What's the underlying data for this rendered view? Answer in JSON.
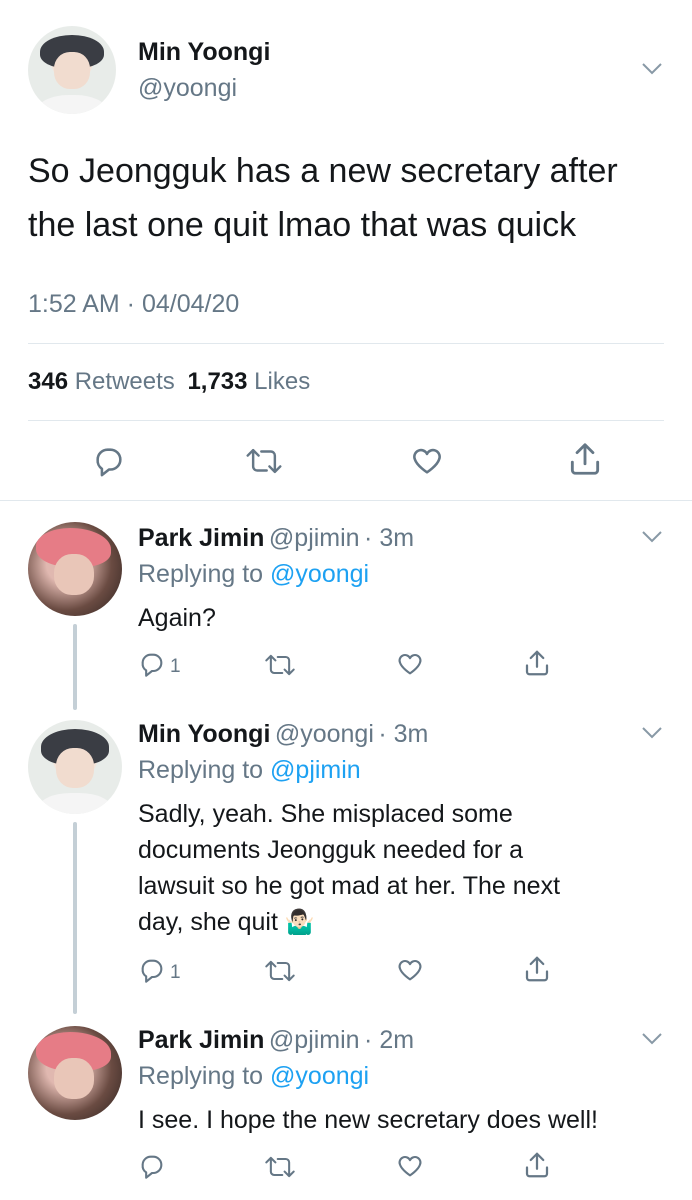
{
  "main_tweet": {
    "name": "Min Yoongi",
    "handle": "@yoongi",
    "text_line1": "So Jeongguk has a new secretary after",
    "text_line2": "the last one quit lmao that was quick",
    "timestamp": "1:52 AM · 04/04/20",
    "retweets_count": "346",
    "retweets_label": "Retweets",
    "likes_count": "1,733",
    "likes_label": "Likes"
  },
  "replies": [
    {
      "name": "Park Jimin",
      "handle": "@pjimin",
      "time": "· 3m",
      "replying_prefix": "Replying to",
      "replying_to": "@yoongi",
      "text_lines": [
        "Again?"
      ],
      "reply_count": "1"
    },
    {
      "name": "Min Yoongi",
      "handle": "@yoongi",
      "time": "· 3m",
      "replying_prefix": "Replying to",
      "replying_to": "@pjimin",
      "text_lines": [
        "Sadly, yeah. She misplaced some",
        "documents Jeongguk needed for a",
        "lawsuit so he got mad at her. The next",
        "day, she quit"
      ],
      "emoji": "🤷🏻‍♂️",
      "reply_count": "1"
    },
    {
      "name": "Park Jimin",
      "handle": "@pjimin",
      "time": "· 2m",
      "replying_prefix": "Replying to",
      "replying_to": "@yoongi",
      "text_lines": [
        "I see. I hope the new secretary does well!"
      ],
      "reply_count": ""
    }
  ],
  "icons": {
    "reply": "reply-icon",
    "retweet": "retweet-icon",
    "like": "heart-icon",
    "share": "share-icon",
    "menu": "chevron-down-icon"
  },
  "colors": {
    "link": "#1da1f2",
    "secondary_text": "#657786",
    "divider": "#e1e8ed",
    "icon": "#657786"
  }
}
